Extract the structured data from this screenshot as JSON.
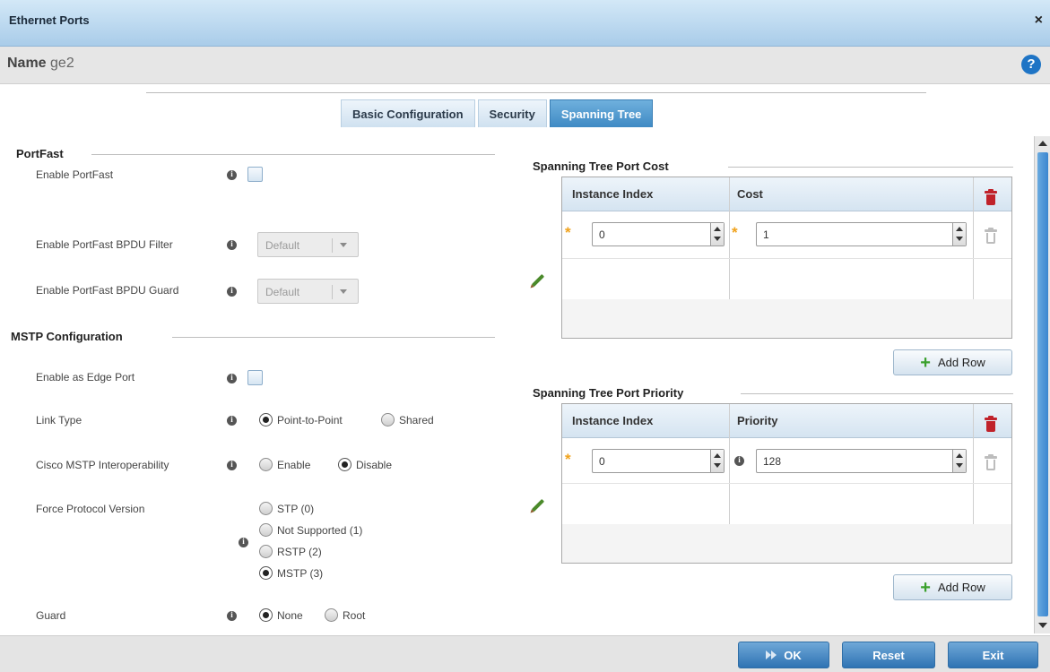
{
  "window": {
    "title": "Ethernet Ports",
    "close_glyph": "×"
  },
  "name_bar": {
    "label": "Name",
    "value": "ge2",
    "help_glyph": "?"
  },
  "tabs": [
    {
      "label": "Basic Configuration",
      "active": false
    },
    {
      "label": "Security",
      "active": false
    },
    {
      "label": "Spanning Tree",
      "active": true
    }
  ],
  "portfast": {
    "section_title": "PortFast",
    "enable_portfast": {
      "label": "Enable PortFast",
      "checked": false
    },
    "bpdu_filter": {
      "label": "Enable PortFast BPDU Filter",
      "value": "Default"
    },
    "bpdu_guard": {
      "label": "Enable PortFast BPDU Guard",
      "value": "Default"
    }
  },
  "mstp": {
    "section_title": "MSTP Configuration",
    "edge_port": {
      "label": "Enable as Edge Port",
      "checked": false
    },
    "link_type": {
      "label": "Link Type",
      "options": [
        "Point-to-Point",
        "Shared"
      ],
      "selected": "Point-to-Point"
    },
    "cisco_interop": {
      "label": "Cisco MSTP Interoperability",
      "options": [
        "Enable",
        "Disable"
      ],
      "selected": "Disable"
    },
    "force_protocol": {
      "label": "Force Protocol Version",
      "options": [
        "STP (0)",
        "Not Supported (1)",
        "RSTP (2)",
        "MSTP (3)"
      ],
      "selected": "MSTP (3)"
    },
    "guard": {
      "label": "Guard",
      "options": [
        "None",
        "Root"
      ],
      "selected": "None"
    }
  },
  "port_cost": {
    "section_title": "Spanning Tree Port Cost",
    "columns": [
      "Instance Index",
      "Cost"
    ],
    "rows": [
      {
        "instance_index": "0",
        "cost": "1"
      }
    ],
    "add_row_label": "Add Row"
  },
  "port_priority": {
    "section_title": "Spanning Tree Port Priority",
    "columns": [
      "Instance Index",
      "Priority"
    ],
    "rows": [
      {
        "instance_index": "0",
        "priority": "128"
      }
    ],
    "add_row_label": "Add Row"
  },
  "footer": {
    "ok_label": "OK",
    "reset_label": "Reset",
    "exit_label": "Exit"
  },
  "icons": {
    "info": "info-icon",
    "delete_all": "trash-icon",
    "delete_row": "trash-icon",
    "edit": "pencil-icon",
    "add": "plus-icon",
    "required": "asterisk-icon",
    "ok": "double-arrow-icon"
  },
  "colors": {
    "accent": "#3f8ac4",
    "required_star": "#f0a21b",
    "delete_red": "#c0222a",
    "add_green": "#3aa02c"
  }
}
